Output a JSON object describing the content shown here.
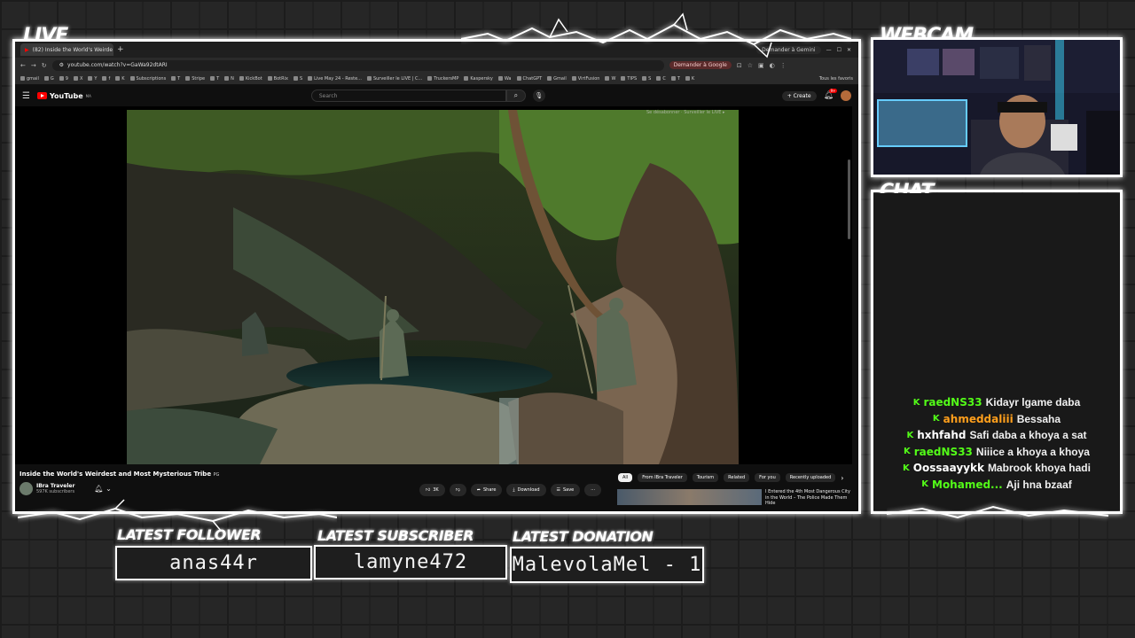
{
  "overlay": {
    "live_label": "LIVE",
    "webcam_label": "WEBCAM",
    "chat_label": "CHAT",
    "latest_follower_label": "LATEST FOLLOWER",
    "latest_follower_value": "anas44r",
    "latest_subscriber_label": "LATEST SUBSCRIBER",
    "latest_subscriber_value": "lamyne472",
    "latest_donation_label": "LATEST DONATION",
    "latest_donation_value": "MalevolaMel - 1"
  },
  "browser": {
    "tab_title": "(82) Inside the World's Weirde",
    "gemini_button": "Demander à Gemini",
    "url": "youtube.com/watch?v=GaWa92dtARI",
    "google_button": "Demander à Google",
    "bookmarks": [
      "gmail",
      "G",
      "9",
      "X",
      "Y",
      "f",
      "K",
      "Subscriptions",
      "T",
      "Stripe",
      "T",
      "N",
      "KickBot",
      "BotRix",
      "S",
      "Live May 24 - Reste...",
      "Surveiller le LIVE | C...",
      "TruckersMP",
      "Kaspersky",
      "Wa",
      "ChatGPT",
      "Gmail",
      "VirtFusion",
      "W",
      "TIPS",
      "S",
      "C",
      "T",
      "K"
    ],
    "all_bookmarks": "Tous les favoris"
  },
  "youtube": {
    "logo_text": "YouTube",
    "logo_region": "MA",
    "search_placeholder": "Search",
    "create_label": "Create",
    "notif_count": "9+",
    "overlay_text": "Se désabonner  ·  Surveiller le LIVE ▸",
    "video_title": "Inside the World's Weirdest and Most Mysterious Tribe",
    "video_title_badge": "PG",
    "channel_name": "IBra Traveler",
    "channel_subs": "597K subscribers",
    "actions": {
      "like": "3K",
      "share": "Share",
      "download": "Download",
      "save": "Save",
      "more": "···"
    },
    "chips": [
      "All",
      "From IBra Traveler",
      "Tourism",
      "Related",
      "For you",
      "Recently uploaded"
    ],
    "reco_title": "I Entered the 4th Most Dangerous City in the World – The Police Made Them Hide"
  },
  "chat": {
    "messages": [
      {
        "user": "raedNS33",
        "user_color": "#53fc18",
        "text": "Kidayr lgame daba"
      },
      {
        "user": "ahmeddaliii",
        "user_color": "#ff9f1c",
        "text": "Bessaha"
      },
      {
        "user": "hxhfahd",
        "user_color": "#ffffff",
        "text": "Safi daba a khoya a sat"
      },
      {
        "user": "raedNS33",
        "user_color": "#53fc18",
        "text": "Niiice a khoya a khoya"
      },
      {
        "user": "Oossaayykk",
        "user_color": "#ffffff",
        "text": "Mabrook khoya hadi"
      },
      {
        "user": "Mohamed...",
        "user_color": "#53fc18",
        "text": "Aji hna bzaaf"
      }
    ]
  }
}
